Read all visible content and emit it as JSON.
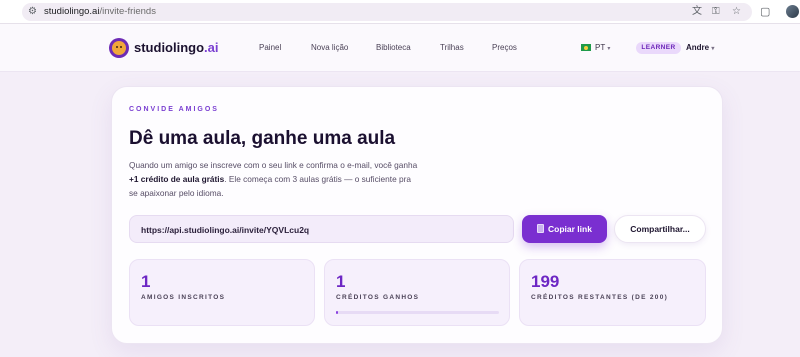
{
  "browser": {
    "url_host": "studiolingo.ai",
    "url_path": "/invite-friends"
  },
  "header": {
    "brand_name": "studiolingo",
    "brand_suffix": ".ai",
    "nav": [
      {
        "label": "Painel"
      },
      {
        "label": "Nova lição"
      },
      {
        "label": "Biblioteca"
      },
      {
        "label": "Trilhas"
      },
      {
        "label": "Preços"
      }
    ],
    "language": "PT",
    "language_caret": "▾",
    "role_badge": "LEARNER",
    "user_name": "Andre",
    "user_caret": "▾"
  },
  "invite": {
    "eyebrow": "CONVIDE AMIGOS",
    "title": "Dê uma aula, ganhe uma aula",
    "desc_part1": "Quando um amigo se inscreve com o seu link e confirma o e-mail, você ganha ",
    "desc_bold1": "+1 crédito de aula grátis",
    "desc_part2": ". Ele começa com 3 aulas grátis — o suficiente pra se apaixonar pelo idioma.",
    "link": "https://api.studiolingo.ai/invite/YQVLcu2q",
    "copy_label": "Copiar link",
    "share_label": "Compartilhar..."
  },
  "stats": [
    {
      "value": "1",
      "label": "AMIGOS INSCRITOS"
    },
    {
      "value": "1",
      "label": "CRÉDITOS GANHOS",
      "progress_fraction": 0.01
    },
    {
      "value": "199",
      "label": "CRÉDITOS RESTANTES (DE 200)"
    }
  ],
  "colors": {
    "accent": "#7a2fd0",
    "stat_number": "#6d27c4",
    "badge_bg": "#ead9fb"
  }
}
